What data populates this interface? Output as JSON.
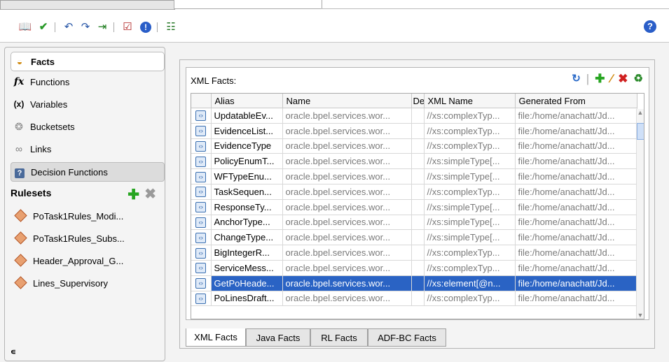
{
  "toolbar": {
    "icons": [
      "book-icon",
      "check-icon",
      "undo-icon",
      "redo-icon",
      "import-icon",
      "validate-icon",
      "error-icon",
      "tree-icon",
      "help-icon"
    ],
    "help_label": "?"
  },
  "sidebar": {
    "items": [
      {
        "label": "Facts",
        "icon": "facts-icon"
      },
      {
        "label": "Functions",
        "icon": "functions-icon",
        "glyph": "fx"
      },
      {
        "label": "Variables",
        "icon": "variables-icon",
        "glyph": "(x)"
      },
      {
        "label": "Bucketsets",
        "icon": "bucketsets-icon"
      },
      {
        "label": "Links",
        "icon": "links-icon"
      },
      {
        "label": "Decision Functions",
        "icon": "decision-functions-icon",
        "glyph": "?"
      }
    ],
    "rulesets_title": "Rulesets",
    "rulesets": [
      {
        "label": "PoTask1Rules_Modi..."
      },
      {
        "label": "PoTask1Rules_Subs..."
      },
      {
        "label": "Header_Approval_G..."
      },
      {
        "label": "Lines_Supervisory"
      }
    ],
    "bottom_mark": "∊"
  },
  "panel": {
    "title": "XML Facts:",
    "columns": [
      "",
      "Alias",
      "Name",
      "De",
      "XML Name",
      "Generated From"
    ],
    "rows": [
      {
        "alias": "UpdatableEv...",
        "name": "oracle.bpel.services.wor...",
        "xml_name": "//xs:complexTyp...",
        "from": "file:/home/anachatt/Jd..."
      },
      {
        "alias": "EvidenceList...",
        "name": "oracle.bpel.services.wor...",
        "xml_name": "//xs:complexTyp...",
        "from": "file:/home/anachatt/Jd..."
      },
      {
        "alias": "EvidenceType",
        "name": "oracle.bpel.services.wor...",
        "xml_name": "//xs:complexTyp...",
        "from": "file:/home/anachatt/Jd..."
      },
      {
        "alias": "PolicyEnumT...",
        "name": "oracle.bpel.services.wor...",
        "xml_name": "//xs:simpleType[...",
        "from": "file:/home/anachatt/Jd..."
      },
      {
        "alias": "WFTypeEnu...",
        "name": "oracle.bpel.services.wor...",
        "xml_name": "//xs:simpleType[...",
        "from": "file:/home/anachatt/Jd..."
      },
      {
        "alias": "TaskSequen...",
        "name": "oracle.bpel.services.wor...",
        "xml_name": "//xs:complexTyp...",
        "from": "file:/home/anachatt/Jd..."
      },
      {
        "alias": "ResponseTy...",
        "name": "oracle.bpel.services.wor...",
        "xml_name": "//xs:simpleType[...",
        "from": "file:/home/anachatt/Jd..."
      },
      {
        "alias": "AnchorType...",
        "name": "oracle.bpel.services.wor...",
        "xml_name": "//xs:simpleType[...",
        "from": "file:/home/anachatt/Jd..."
      },
      {
        "alias": "ChangeType...",
        "name": "oracle.bpel.services.wor...",
        "xml_name": "//xs:simpleType[...",
        "from": "file:/home/anachatt/Jd..."
      },
      {
        "alias": "BigIntegerR...",
        "name": "oracle.bpel.services.wor...",
        "xml_name": "//xs:complexTyp...",
        "from": "file:/home/anachatt/Jd..."
      },
      {
        "alias": "ServiceMess...",
        "name": "oracle.bpel.services.wor...",
        "xml_name": "//xs:complexTyp...",
        "from": "file:/home/anachatt/Jd..."
      },
      {
        "alias": "GetPoHeade...",
        "name": "oracle.bpel.services.wor...",
        "xml_name": "//xs:element[@n...",
        "from": "file:/home/anachatt/Jd...",
        "selected": true
      },
      {
        "alias": "PoLinesDraft...",
        "name": "oracle.bpel.services.wor...",
        "xml_name": "//xs:complexTyp...",
        "from": "file:/home/anachatt/Jd..."
      }
    ],
    "tabs": [
      "XML Facts",
      "Java Facts",
      "RL Facts",
      "ADF-BC Facts"
    ],
    "active_tab": "XML Facts"
  },
  "colors": {
    "selection": "#2a63c4",
    "add": "#27a521",
    "delete": "#d02020"
  }
}
